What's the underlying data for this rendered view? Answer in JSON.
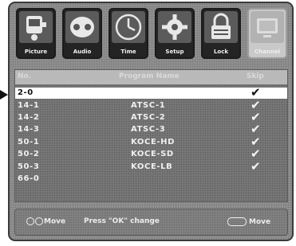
{
  "tabs": [
    {
      "label": "Picture",
      "icon": "camera-icon"
    },
    {
      "label": "Audio",
      "icon": "speaker-icon"
    },
    {
      "label": "Time",
      "icon": "clock-icon"
    },
    {
      "label": "Setup",
      "icon": "gear-icon"
    },
    {
      "label": "Lock",
      "icon": "lock-icon"
    },
    {
      "label": "Channel",
      "icon": "tv-icon",
      "active": true
    }
  ],
  "list": {
    "header": {
      "col1": "No.",
      "col2": "Program Name",
      "col3": "Skip"
    },
    "rows": [
      {
        "number": "2-0",
        "name": "",
        "checked": true,
        "selected": true
      },
      {
        "number": "14-1",
        "name": "ATSC-1",
        "checked": true
      },
      {
        "number": "14-2",
        "name": "ATSC-2",
        "checked": true
      },
      {
        "number": "14-3",
        "name": "ATSC-3",
        "checked": true
      },
      {
        "number": "50-1",
        "name": "KOCE-HD",
        "checked": true
      },
      {
        "number": "50-2",
        "name": "KOCE-SD",
        "checked": true
      },
      {
        "number": "50-3",
        "name": "KOCE-LB",
        "checked": true
      },
      {
        "number": "66-0",
        "name": "",
        "checked": false
      }
    ]
  },
  "footer": {
    "move_label": "Move",
    "press_label": "Press \"OK\" change",
    "menu_move_label": "Move"
  },
  "colors": {
    "accent_panel": "#8e8e8e",
    "selected_row": "#ffffff"
  }
}
